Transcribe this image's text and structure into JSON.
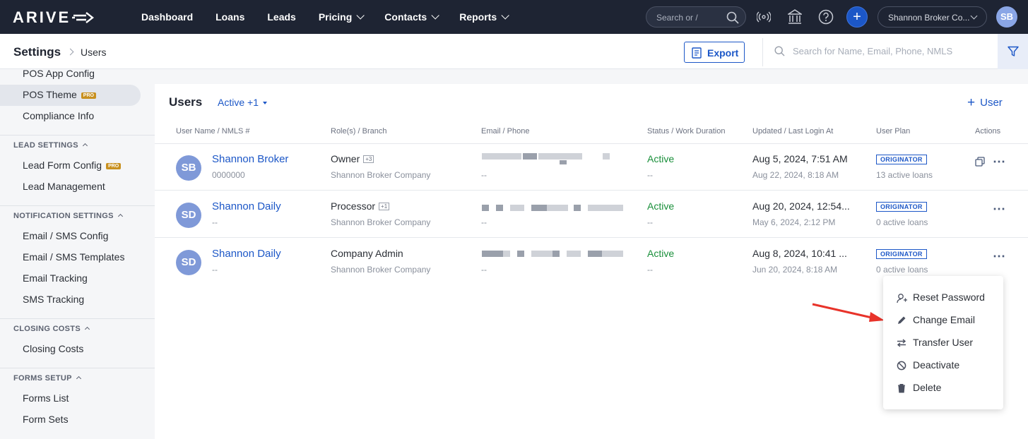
{
  "topnav": {
    "logo": "ARIVE",
    "items": [
      {
        "label": "Dashboard"
      },
      {
        "label": "Loans"
      },
      {
        "label": "Leads"
      },
      {
        "label": "Pricing"
      },
      {
        "label": "Contacts"
      },
      {
        "label": "Reports"
      }
    ],
    "search_placeholder": "Search or /",
    "plus": "+",
    "company": "Shannon Broker Co...",
    "avatar": "SB"
  },
  "subheader": {
    "title": "Settings",
    "current": "Users",
    "export_label": "Export",
    "search_placeholder": "Search for Name, Email, Phone, NMLS"
  },
  "sidebar": {
    "items_top": [
      "POS App Config",
      "POS Theme",
      "Compliance Info"
    ],
    "pro": "PRO",
    "sections": [
      {
        "title": "LEAD SETTINGS",
        "items": [
          "Lead Form Config",
          "Lead Management"
        ]
      },
      {
        "title": "NOTIFICATION SETTINGS",
        "items": [
          "Email / SMS Config",
          "Email / SMS Templates",
          "Email Tracking",
          "SMS Tracking"
        ]
      },
      {
        "title": "CLOSING COSTS",
        "items": [
          "Closing Costs"
        ]
      },
      {
        "title": "FORMS SETUP",
        "items": [
          "Forms List",
          "Form Sets"
        ]
      }
    ]
  },
  "users": {
    "title": "Users",
    "filter": "Active +1",
    "add_label": "User",
    "columns": [
      "User Name / NMLS #",
      "Role(s) / Branch",
      "Email / Phone",
      "Status / Work Duration",
      "Updated / Last Login At",
      "User Plan",
      "Actions"
    ],
    "rows": [
      {
        "initials": "SB",
        "name": "Shannon Broker",
        "nmls": "0000000",
        "role": "Owner",
        "role_extra": "+3",
        "branch": "Shannon Broker Company",
        "phone": "--",
        "status": "Active",
        "duration": "--",
        "updated": "Aug 5, 2024, 7:51 AM",
        "last_login": "Aug 22, 2024, 8:18 AM",
        "plan": "ORIGINATOR",
        "loans": "13 active loans"
      },
      {
        "initials": "SD",
        "name": "Shannon Daily",
        "nmls": "--",
        "role": "Processor",
        "role_extra": "+1",
        "branch": "Shannon Broker Company",
        "phone": "--",
        "status": "Active",
        "duration": "--",
        "updated": "Aug 20, 2024, 12:54...",
        "last_login": "May 6, 2024, 2:12 PM",
        "plan": "ORIGINATOR",
        "loans": "0 active loans"
      },
      {
        "initials": "SD",
        "name": "Shannon Daily",
        "nmls": "--",
        "role": "Company Admin",
        "role_extra": "",
        "branch": "Shannon Broker Company",
        "phone": "--",
        "status": "Active",
        "duration": "--",
        "updated": "Aug 8, 2024, 10:41 ...",
        "last_login": "Jun 20, 2024, 8:18 AM",
        "plan": "ORIGINATOR",
        "loans": "0 active loans"
      }
    ]
  },
  "action_menu": {
    "items": [
      "Reset Password",
      "Change Email",
      "Transfer User",
      "Deactivate",
      "Delete"
    ]
  },
  "colors": {
    "nav_bg": "#1e2433",
    "primary": "#1c57c7",
    "active_green": "#198f3a",
    "annotation_arrow": "#e8332a"
  }
}
